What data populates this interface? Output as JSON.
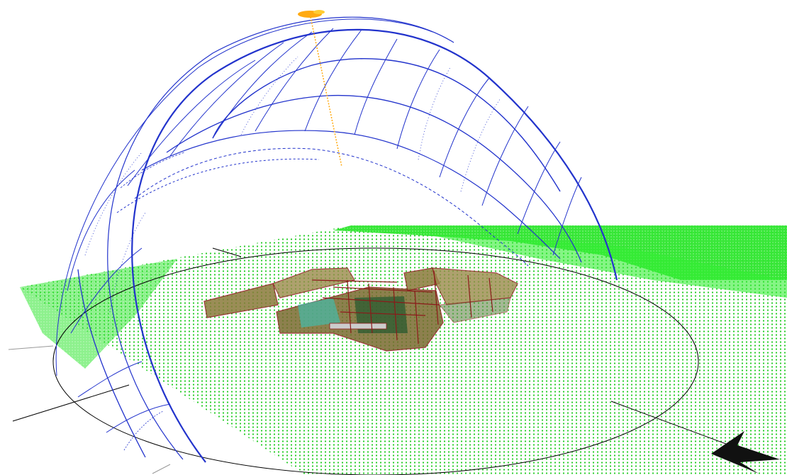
{
  "scene": {
    "background": "#ffffff",
    "colors": {
      "ground_grid": "#22dd22",
      "ground_fill": "#33ee33",
      "sun_path_arc": "#2233cc",
      "sun_path_dashed": "#2233cc",
      "analysis_grid": "#4455dd",
      "compass_circle": "#000000",
      "axis_line": "#000000",
      "sun_marker": "#ffaa11",
      "sun_ray": "#ffaa11",
      "building_fill": "#8a7a3a",
      "building_edge": "#8b1a1a",
      "courtyard_fill": "#44bbaa",
      "north_arrow": "#000000"
    },
    "icons": [
      "north-arrow-icon",
      "sun-marker-icon"
    ]
  }
}
